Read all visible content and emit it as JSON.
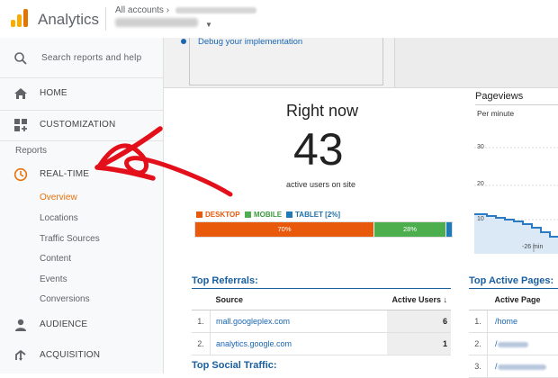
{
  "header": {
    "app_title": "Analytics",
    "all_accounts": "All accounts"
  },
  "sidebar": {
    "search_placeholder": "Search reports and help",
    "home": "HOME",
    "customization": "CUSTOMIZATION",
    "reports_label": "Reports",
    "realtime": "REAL-TIME",
    "realtime_items": [
      "Overview",
      "Locations",
      "Traffic Sources",
      "Content",
      "Events",
      "Conversions"
    ],
    "audience": "AUDIENCE",
    "acquisition": "ACQUISITION"
  },
  "debug": {
    "link": "Debug your implementation"
  },
  "realtime": {
    "title": "Right now",
    "active_users": "43",
    "caption": "active users on site",
    "devices": [
      {
        "label": "DESKTOP",
        "percent": 70,
        "percent_label": "70%",
        "color": "#e8590c"
      },
      {
        "label": "MOBILE",
        "percent": 28,
        "percent_label": "28%",
        "color": "#4cae4c"
      },
      {
        "label": "TABLET [2%]",
        "percent": 2,
        "percent_label": "",
        "color": "#1f7ab8"
      }
    ]
  },
  "pageviews": {
    "title": "Pageviews",
    "subtitle": "Per minute",
    "ticks": [
      "30",
      "20",
      "10"
    ],
    "x_label": "-26 min"
  },
  "top_referrals": {
    "title": "Top Referrals:",
    "col_source": "Source",
    "col_active": "Active Users",
    "rows": [
      {
        "num": "1.",
        "source": "mall.googleplex.com",
        "users": "6"
      },
      {
        "num": "2.",
        "source": "analytics.google.com",
        "users": "1"
      }
    ]
  },
  "top_active_pages": {
    "title": "Top Active Pages:",
    "col_page": "Active Page",
    "rows": [
      {
        "num": "1.",
        "page": "/home"
      },
      {
        "num": "2.",
        "page": "/"
      },
      {
        "num": "3.",
        "page": "/"
      }
    ]
  },
  "top_social": {
    "title": "Top Social Traffic:"
  },
  "colors": {
    "accent_orange": "#e8710a",
    "link_blue": "#1a66b3",
    "section_blue": "#1a5fa0",
    "arrow_red": "#e3101b"
  }
}
